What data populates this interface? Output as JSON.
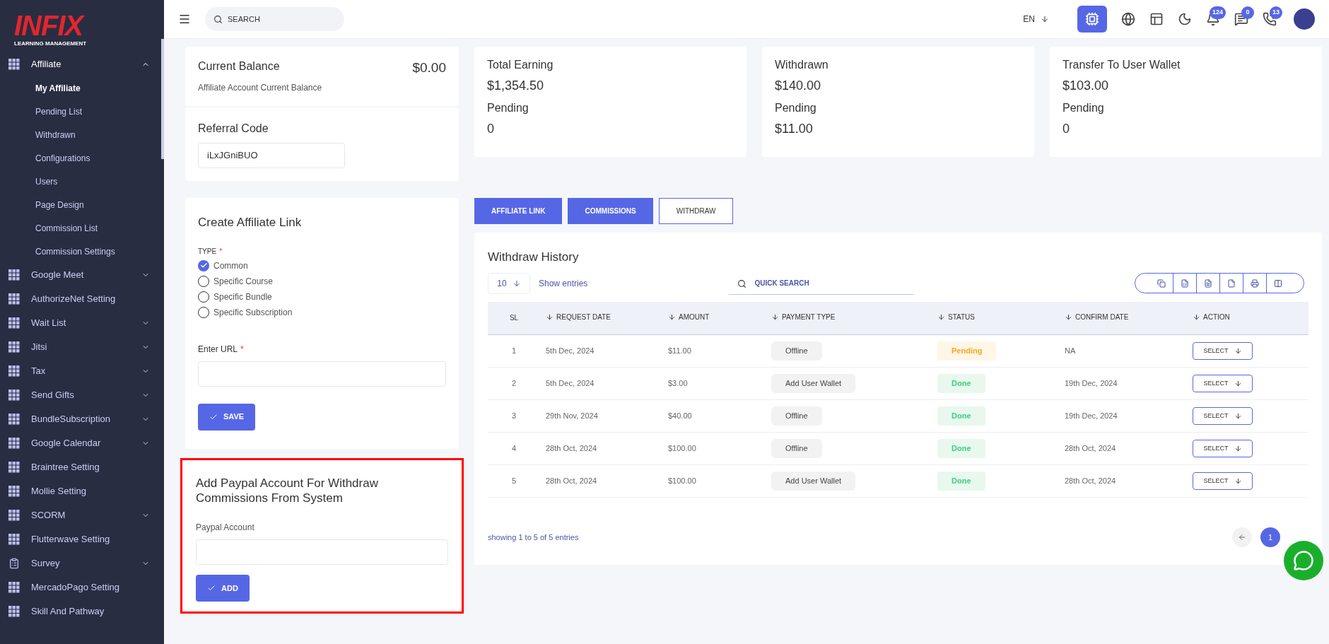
{
  "sidebar": {
    "logo_title": "INFIX",
    "logo_subtitle": "LEARNING MANAGEMENT",
    "items": [
      {
        "label": "Affiliate",
        "kind": "grid",
        "expanded": true,
        "children": [
          {
            "label": "My Affiliate",
            "selected": true
          },
          {
            "label": "Pending List",
            "selected": false
          },
          {
            "label": "Withdrawn",
            "selected": false
          },
          {
            "label": "Configurations",
            "selected": false
          },
          {
            "label": "Users",
            "selected": false
          },
          {
            "label": "Page Design",
            "selected": false
          },
          {
            "label": "Commission List",
            "selected": false
          },
          {
            "label": "Commission Settings",
            "selected": false
          }
        ]
      },
      {
        "label": "Google Meet",
        "kind": "grid",
        "expanded": false
      },
      {
        "label": "AuthorizeNet Setting",
        "kind": "grid"
      },
      {
        "label": "Wait List",
        "kind": "grid",
        "expanded": false
      },
      {
        "label": "Jitsi",
        "kind": "grid",
        "expanded": false
      },
      {
        "label": "Tax",
        "kind": "grid",
        "expanded": false
      },
      {
        "label": "Send Gifts",
        "kind": "grid",
        "expanded": false
      },
      {
        "label": "BundleSubscription",
        "kind": "grid",
        "expanded": false
      },
      {
        "label": "Google Calendar",
        "kind": "grid",
        "expanded": false
      },
      {
        "label": "Braintree Setting",
        "kind": "grid"
      },
      {
        "label": "Mollie Setting",
        "kind": "grid"
      },
      {
        "label": "SCORM",
        "kind": "grid",
        "expanded": false
      },
      {
        "label": "Flutterwave Setting",
        "kind": "grid"
      },
      {
        "label": "Survey",
        "kind": "form",
        "expanded": false
      },
      {
        "label": "MercadoPago Setting",
        "kind": "grid"
      },
      {
        "label": "Skill And Pathway",
        "kind": "grid"
      }
    ]
  },
  "header": {
    "search_placeholder": "SEARCH",
    "language": "EN",
    "notification_count": "124",
    "message_count": "0",
    "chat_count": "13"
  },
  "balance_card": {
    "title": "Current Balance",
    "amount": "$0.00",
    "subtitle": "Affiliate Account Current Balance"
  },
  "referral_card": {
    "title": "Referral Code",
    "code": "iLxJGniBUO"
  },
  "stats": [
    {
      "title": "Total Earning",
      "amount": "$1,354.50",
      "pending_label": "Pending",
      "pending": "0"
    },
    {
      "title": "Withdrawn",
      "amount": "$140.00",
      "pending_label": "Pending",
      "pending": "$11.00"
    },
    {
      "title": "Transfer To User Wallet",
      "amount": "$103.00",
      "pending_label": "Pending",
      "pending": "0"
    }
  ],
  "create_link": {
    "title": "Create Affiliate Link",
    "type_label": "TYPE",
    "required_mark": "*",
    "options": [
      {
        "label": "Common",
        "selected": true
      },
      {
        "label": "Specific Course",
        "selected": false
      },
      {
        "label": "Specific Bundle",
        "selected": false
      },
      {
        "label": "Specific Subscription",
        "selected": false
      }
    ],
    "url_label": "Enter URL",
    "url_required_mark": "*",
    "save_button": "SAVE"
  },
  "paypal": {
    "title": "Add Paypal Account For Withdraw Commissions From System",
    "field_label": "Paypal Account",
    "add_button": "ADD"
  },
  "tabs": [
    {
      "label": "AFFILIATE LINK",
      "selected": false
    },
    {
      "label": "COMMISSIONS",
      "selected": false
    },
    {
      "label": "WITHDRAW",
      "selected": true
    }
  ],
  "table": {
    "title": "Withdraw History",
    "page_size": "10",
    "show_entries": "Show entries",
    "search_placeholder": "QUICK SEARCH",
    "columns": [
      "SL",
      "REQUEST DATE",
      "AMOUNT",
      "PAYMENT TYPE",
      "STATUS",
      "CONFIRM DATE",
      "ACTION"
    ],
    "rows": [
      {
        "sl": "1",
        "request_date": "5th Dec, 2024",
        "amount": "$11.00",
        "payment_type": "Offline",
        "status": "Pending",
        "kind": "pending",
        "confirm_date": "NA",
        "action": "SELECT"
      },
      {
        "sl": "2",
        "request_date": "5th Dec, 2024",
        "amount": "$3.00",
        "payment_type": "Add User Wallet",
        "status": "Done",
        "kind": "done",
        "confirm_date": "19th Dec, 2024",
        "action": "SELECT"
      },
      {
        "sl": "3",
        "request_date": "29th Nov, 2024",
        "amount": "$40.00",
        "payment_type": "Offline",
        "status": "Done",
        "kind": "done",
        "confirm_date": "19th Dec, 2024",
        "action": "SELECT"
      },
      {
        "sl": "4",
        "request_date": "28th Oct, 2024",
        "amount": "$100.00",
        "payment_type": "Offline",
        "status": "Done",
        "kind": "done",
        "confirm_date": "28th Oct, 2024",
        "action": "SELECT"
      },
      {
        "sl": "5",
        "request_date": "28th Oct, 2024",
        "amount": "$100.00",
        "payment_type": "Add User Wallet",
        "status": "Done",
        "kind": "done",
        "confirm_date": "28th Oct, 2024",
        "action": "SELECT"
      }
    ],
    "footer": "showing 1 to 5 of 5 entries",
    "pages": [
      {
        "label": "1",
        "selected": true
      }
    ]
  }
}
